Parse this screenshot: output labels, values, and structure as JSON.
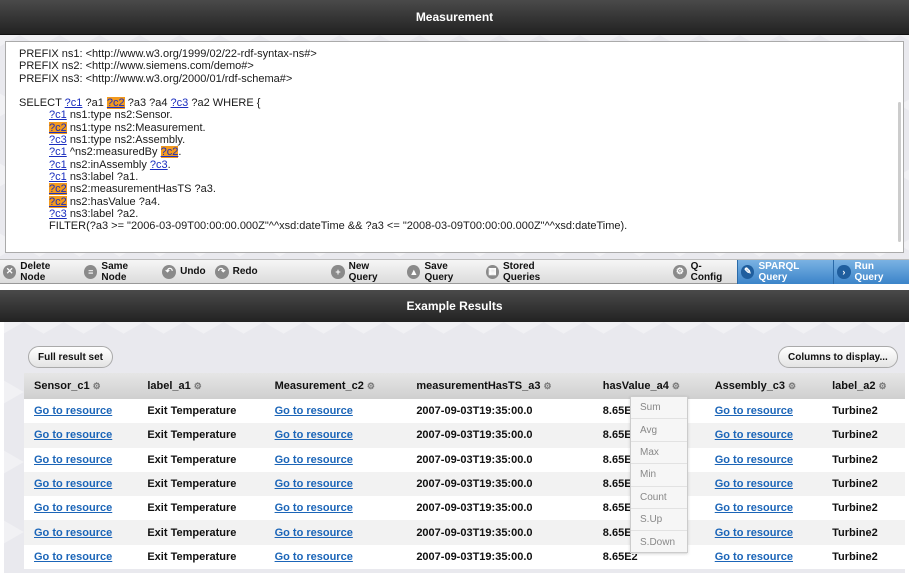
{
  "window": {
    "title": "Measurement"
  },
  "query": {
    "prefixes": [
      "PREFIX ns1: <http://www.w3.org/1999/02/22-rdf-syntax-ns#>",
      "PREFIX ns2: <http://www.siemens.com/demo#>",
      "PREFIX ns3: <http://www.w3.org/2000/01/rdf-schema#>"
    ],
    "select_keyword": "SELECT",
    "var_c1": "?c1",
    "var_c2": "?c2",
    "var_c3": "?c3",
    "var_a1": "?a1",
    "select_mid": "?a3 ?a4",
    "select_tail": "?a2 WHERE {",
    "l1": "ns1:type ns2:Sensor.",
    "l2": "ns1:type ns2:Measurement.",
    "l3": "ns1:type ns2:Assembly.",
    "l4a": "^ns2:measuredBy",
    "l4b": ".",
    "l5a": "ns2:inAssembly",
    "l5b": ".",
    "l6": "ns3:label ?a1.",
    "l7": "ns2:measurementHasTS ?a3.",
    "l8": "ns2:hasValue ?a4.",
    "l9": "ns3:label ?a2.",
    "filter": "FILTER(?a3 >= \"2006-03-09T00:00:00.000Z\"^^xsd:dateTime && ?a3 <= \"2008-03-09T00:00:00.000Z\"^^xsd:dateTime)."
  },
  "toolbar": {
    "delete_node": "Delete Node",
    "same_node": "Same Node",
    "undo": "Undo",
    "redo": "Redo",
    "new_query": "New Query",
    "save_query": "Save Query",
    "stored_queries": "Stored Queries",
    "q_config": "Q-Config",
    "sparql_query": "SPARQL Query",
    "run_query": "Run Query"
  },
  "results": {
    "title": "Example Results",
    "full_result_set": "Full result set",
    "columns_to_display": "Columns to display...",
    "columns": [
      "Sensor_c1",
      "label_a1",
      "Measurement_c2",
      "measurementHasTS_a3",
      "hasValue_a4",
      "Assembly_c3",
      "label_a2"
    ],
    "rows": [
      [
        "Go to resource",
        "Exit Temperature",
        "Go to resource",
        "2007-09-03T19:35:00.0",
        "8.65E2",
        "Go to resource",
        "Turbine2"
      ],
      [
        "Go to resource",
        "Exit Temperature",
        "Go to resource",
        "2007-09-03T19:35:00.0",
        "8.65E2",
        "Go to resource",
        "Turbine2"
      ],
      [
        "Go to resource",
        "Exit Temperature",
        "Go to resource",
        "2007-09-03T19:35:00.0",
        "8.65E2",
        "Go to resource",
        "Turbine2"
      ],
      [
        "Go to resource",
        "Exit Temperature",
        "Go to resource",
        "2007-09-03T19:35:00.0",
        "8.65E2",
        "Go to resource",
        "Turbine2"
      ],
      [
        "Go to resource",
        "Exit Temperature",
        "Go to resource",
        "2007-09-03T19:35:00.0",
        "8.65E2",
        "Go to resource",
        "Turbine2"
      ],
      [
        "Go to resource",
        "Exit Temperature",
        "Go to resource",
        "2007-09-03T19:35:00.0",
        "8.65E2",
        "Go to resource",
        "Turbine2"
      ],
      [
        "Go to resource",
        "Exit Temperature",
        "Go to resource",
        "2007-09-03T19:35:00.0",
        "8.65E2",
        "Go to resource",
        "Turbine2"
      ]
    ],
    "aggregate_menu": [
      "Sum",
      "Avg",
      "Max",
      "Min",
      "Count",
      "S.Up",
      "S.Down"
    ]
  },
  "colors": {
    "link": "#1b65b8",
    "highlight": "#f29a1e",
    "accent": "#3b84c9"
  }
}
